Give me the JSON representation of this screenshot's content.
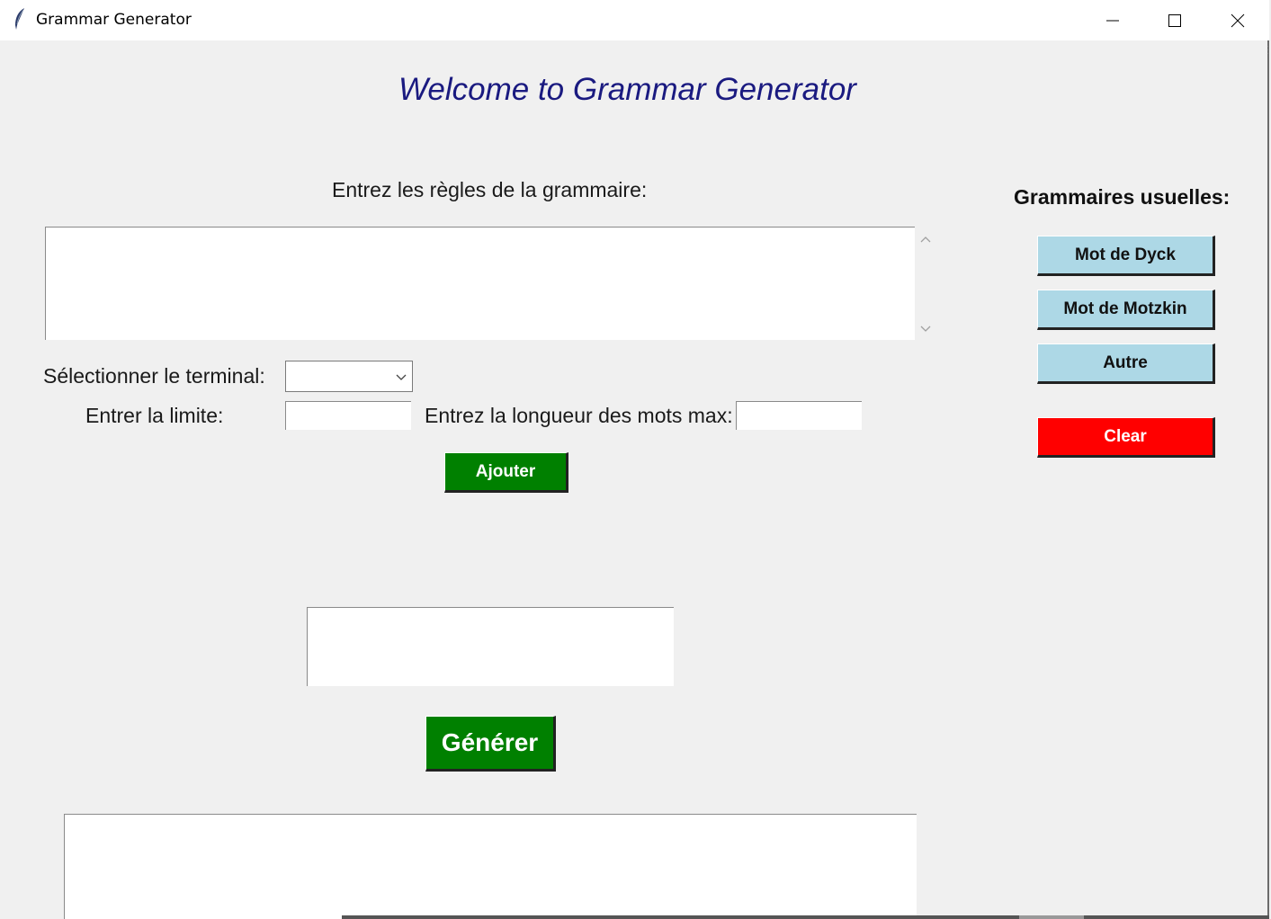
{
  "window": {
    "title": "Grammar Generator",
    "icon": "feather-icon"
  },
  "header": {
    "welcome": "Welcome to Grammar Generator"
  },
  "rules": {
    "label": "Entrez les règles de la grammaire:",
    "value": ""
  },
  "terminal": {
    "label": "Sélectionner le terminal:",
    "selected": ""
  },
  "limit": {
    "label": "Entrer la limite:",
    "value": ""
  },
  "maxlen": {
    "label": "Entrez la longueur des mots max:",
    "value": ""
  },
  "buttons": {
    "ajouter": "Ajouter",
    "generer": "Générer"
  },
  "sidebar": {
    "title": "Grammaires usuelles:",
    "items": [
      {
        "label": "Mot de Dyck"
      },
      {
        "label": "Mot de Motzkin"
      },
      {
        "label": "Autre"
      }
    ],
    "clear": "Clear"
  },
  "colors": {
    "accent_green": "#008000",
    "side_button": "#add8e6",
    "clear_button": "#ff0000",
    "welcome_text": "#1a1a80",
    "background": "#f0f0f0"
  }
}
